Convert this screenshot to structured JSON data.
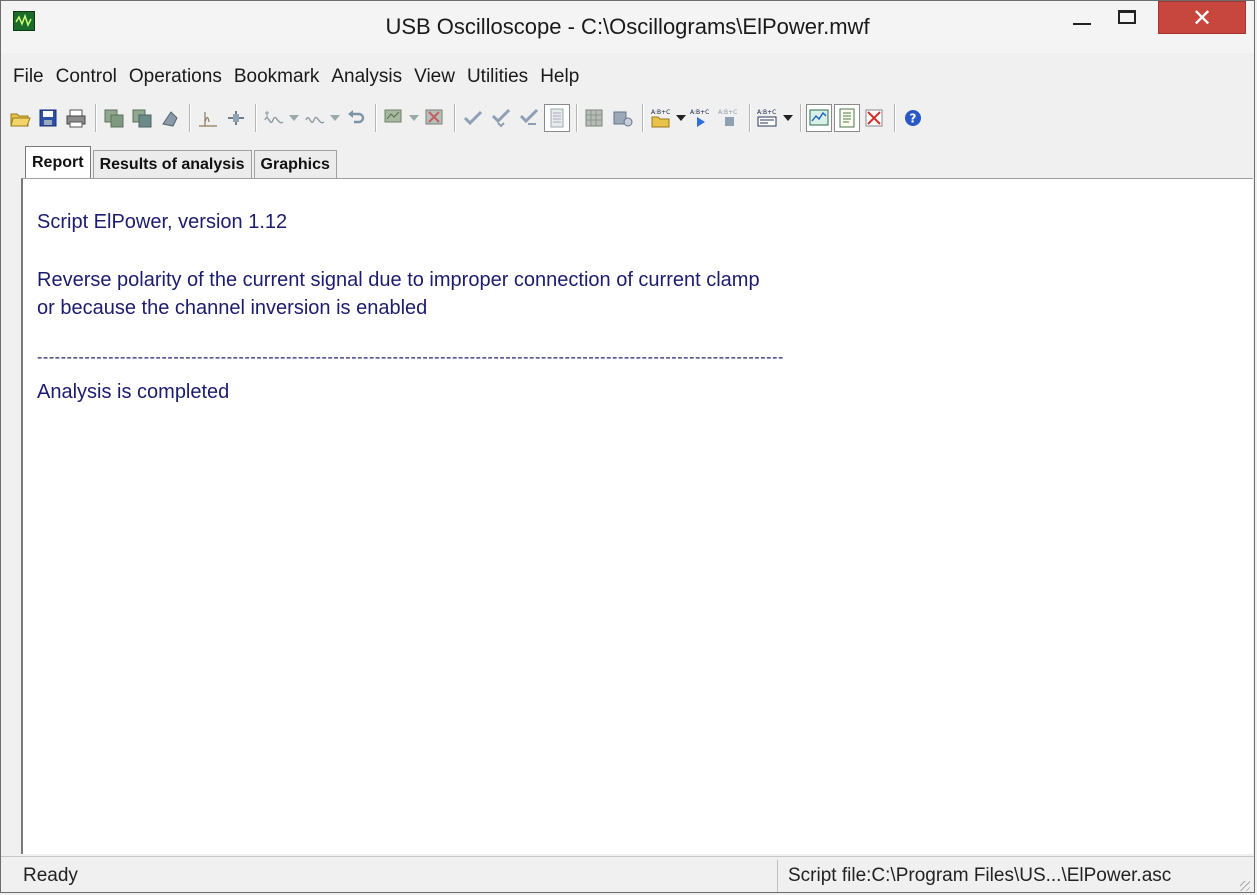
{
  "window": {
    "title": "USB Oscilloscope - C:\\Oscillograms\\ElPower.mwf"
  },
  "menu": [
    "File",
    "Control",
    "Operations",
    "Bookmark",
    "Analysis",
    "View",
    "Utilities",
    "Help"
  ],
  "toolbar": {
    "icons": [
      "open-icon",
      "save-icon",
      "print-icon",
      "copy-channel-icon",
      "paste-channel-icon",
      "tool-icon",
      "marker-icon",
      "cursor-icon",
      "filter-icon",
      "filter-dropdown",
      "filter2-icon",
      "filter2-dropdown",
      "undo-icon",
      "chart-icon",
      "chart-dropdown",
      "delete-chart-icon",
      "check-icon",
      "check-down-icon",
      "check-next-icon",
      "page-icon",
      "grid-icon",
      "export-icon",
      "script-open-icon",
      "script-open-dropdown",
      "script-run-icon",
      "script-stop-icon",
      "script-params-icon",
      "script-params-dropdown",
      "graph-window-icon",
      "report-window-icon",
      "close-window-icon",
      "help-icon"
    ]
  },
  "tabs": [
    {
      "label": "Report",
      "active": true
    },
    {
      "label": "Results of analysis",
      "active": false
    },
    {
      "label": "Graphics",
      "active": false
    }
  ],
  "report": {
    "line1": "Script ElPower, version 1.12",
    "line2": "Reverse polarity of the current signal due to improper connection of current clamp",
    "line3": "or because the channel inversion is enabled",
    "separator": "------------------------------------------------------------------------------------------------------------------------------",
    "line4": "Analysis is completed"
  },
  "status": {
    "left": "Ready",
    "right": "Script file:C:\\Program Files\\US...\\ElPower.asc"
  },
  "colors": {
    "report_text": "#1c1c6e",
    "close_button": "#c7463d"
  }
}
